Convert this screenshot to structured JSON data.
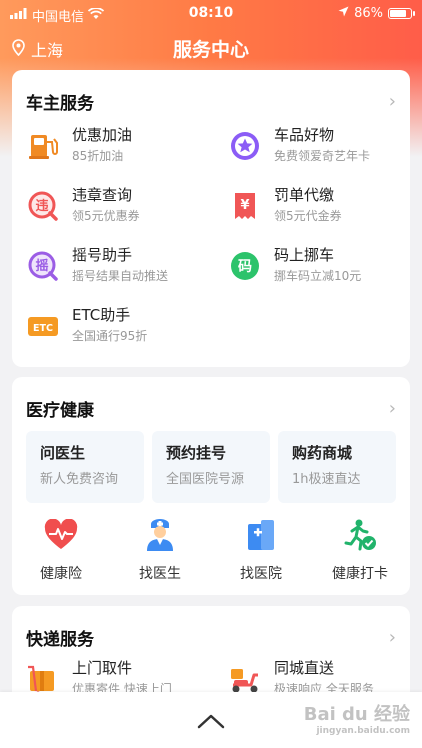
{
  "status_bar": {
    "carrier": "中国电信",
    "time": "08:10",
    "battery": "86%",
    "battery_level": 0.86
  },
  "nav": {
    "location": "上海",
    "title": "服务中心"
  },
  "owner_services": {
    "title": "车主服务",
    "items": [
      {
        "title": "优惠加油",
        "subtitle": "85折加油",
        "icon": "fuel-pump-icon"
      },
      {
        "title": "车品好物",
        "subtitle": "免费领爱奇艺年卡",
        "icon": "star-badge-icon"
      },
      {
        "title": "违章查询",
        "subtitle": "领5元优惠券",
        "icon": "violation-search-icon"
      },
      {
        "title": "罚单代缴",
        "subtitle": "领5元代金券",
        "icon": "ticket-payment-icon"
      },
      {
        "title": "摇号助手",
        "subtitle": "摇号结果自动推送",
        "icon": "lottery-search-icon"
      },
      {
        "title": "码上挪车",
        "subtitle": "挪车码立减10元",
        "icon": "move-car-code-icon"
      },
      {
        "title": "ETC助手",
        "subtitle": "全国通行95折",
        "icon": "etc-card-icon"
      }
    ],
    "icon_glyphs": {
      "violation": "违",
      "ticket": "¥",
      "lottery": "摇",
      "code": "码",
      "etc": "ETC"
    }
  },
  "health": {
    "title": "医疗健康",
    "tiles": [
      {
        "title": "问医生",
        "subtitle": "新人免费咨询"
      },
      {
        "title": "预约挂号",
        "subtitle": "全国医院号源"
      },
      {
        "title": "购药商城",
        "subtitle": "1h极速直达"
      }
    ],
    "icons": [
      {
        "label": "健康险",
        "icon": "heart-pulse-icon"
      },
      {
        "label": "找医生",
        "icon": "doctor-icon"
      },
      {
        "label": "找医院",
        "icon": "hospital-icon"
      },
      {
        "label": "健康打卡",
        "icon": "running-check-icon"
      }
    ]
  },
  "delivery": {
    "title": "快递服务",
    "items": [
      {
        "title": "上门取件",
        "subtitle": "优惠寄件 快速上门",
        "icon": "parcel-icon"
      },
      {
        "title": "同城直送",
        "subtitle": "极速响应 全天服务",
        "icon": "scooter-icon"
      }
    ]
  },
  "watermark": {
    "text": "Bai du 经验",
    "sub": "jingyan.baidu.com"
  },
  "colors": {
    "header_gradient_start": "#ff9a5c",
    "header_gradient_end": "#ff5d49",
    "fuel": "#f08a24",
    "violation": "#f05656",
    "lottery": "#9b5de5",
    "code": "#2cc36b",
    "etc": "#f59a23",
    "health_red": "#f04e4e",
    "doctor_blue": "#3d8bf2",
    "run_green": "#21b36b"
  }
}
